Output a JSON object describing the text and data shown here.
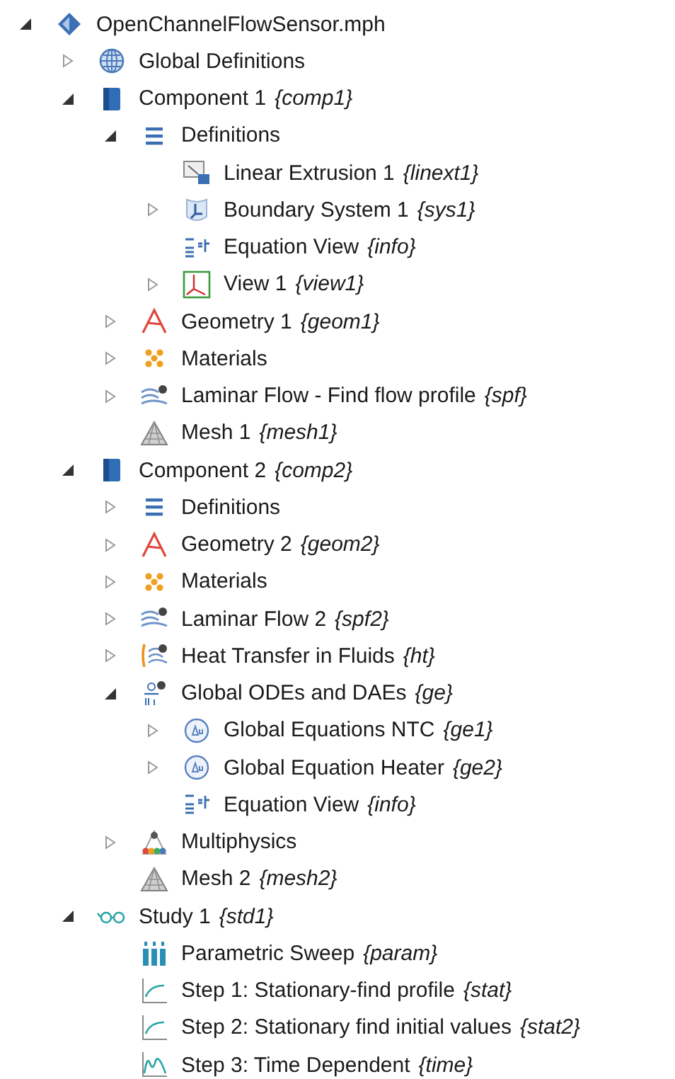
{
  "tree": [
    {
      "label": "OpenChannelFlowSensor.mph",
      "kind": "model",
      "expanded": true,
      "children": [
        {
          "label": "Global Definitions",
          "kind": "globe",
          "expanded": false
        },
        {
          "label": "Component 1",
          "tag": "{comp1}",
          "kind": "component",
          "expanded": true,
          "children": [
            {
              "label": "Definitions",
              "kind": "definitions",
              "expanded": true,
              "children": [
                {
                  "label": "Linear Extrusion 1",
                  "tag": "{linext1}",
                  "kind": "extrusion"
                },
                {
                  "label": "Boundary System 1",
                  "tag": "{sys1}",
                  "kind": "coord-system",
                  "expanded": false
                },
                {
                  "label": "Equation View",
                  "tag": "{info}",
                  "kind": "equation"
                },
                {
                  "label": "View 1",
                  "tag": "{view1}",
                  "kind": "view",
                  "expanded": false
                }
              ]
            },
            {
              "label": "Geometry 1",
              "tag": "{geom1}",
              "kind": "geometry",
              "expanded": false
            },
            {
              "label": "Materials",
              "kind": "materials",
              "expanded": false
            },
            {
              "label": "Laminar Flow - Find flow profile",
              "tag": "{spf}",
              "kind": "laminar-flow",
              "expanded": false
            },
            {
              "label": "Mesh 1",
              "tag": "{mesh1}",
              "kind": "mesh"
            }
          ]
        },
        {
          "label": "Component 2",
          "tag": "{comp2}",
          "kind": "component",
          "expanded": true,
          "children": [
            {
              "label": "Definitions",
              "kind": "definitions",
              "expanded": false
            },
            {
              "label": "Geometry 2",
              "tag": "{geom2}",
              "kind": "geometry",
              "expanded": false
            },
            {
              "label": "Materials",
              "kind": "materials",
              "expanded": false
            },
            {
              "label": "Laminar Flow 2",
              "tag": "{spf2}",
              "kind": "laminar-flow",
              "expanded": false
            },
            {
              "label": "Heat Transfer in Fluids",
              "tag": "{ht}",
              "kind": "heat",
              "expanded": false
            },
            {
              "label": "Global ODEs and DAEs",
              "tag": "{ge}",
              "kind": "ode",
              "expanded": true,
              "children": [
                {
                  "label": "Global Equations NTC",
                  "tag": "{ge1}",
                  "kind": "global-equation",
                  "expanded": false
                },
                {
                  "label": "Global Equation Heater",
                  "tag": "{ge2}",
                  "kind": "global-equation",
                  "expanded": false
                },
                {
                  "label": "Equation View",
                  "tag": "{info}",
                  "kind": "equation"
                }
              ]
            },
            {
              "label": "Multiphysics",
              "kind": "multiphysics",
              "expanded": false
            },
            {
              "label": "Mesh 2",
              "tag": "{mesh2}",
              "kind": "mesh"
            }
          ]
        },
        {
          "label": "Study 1",
          "tag": "{std1}",
          "kind": "study",
          "expanded": true,
          "children": [
            {
              "label": "Parametric Sweep",
              "tag": "{param}",
              "kind": "sweep"
            },
            {
              "label": "Step 1: Stationary-find profile",
              "tag": "{stat}",
              "kind": "stationary-step"
            },
            {
              "label": "Step 2: Stationary find initial values",
              "tag": "{stat2}",
              "kind": "stationary-step"
            },
            {
              "label": "Step 3: Time Dependent",
              "tag": "{time}",
              "kind": "time-step"
            }
          ]
        }
      ]
    }
  ]
}
